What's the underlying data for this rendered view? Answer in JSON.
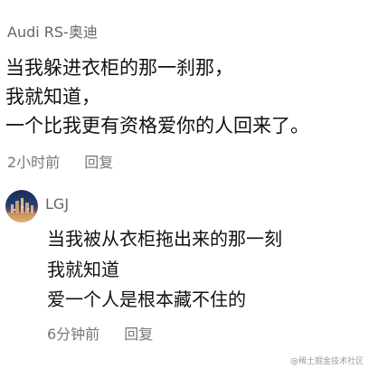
{
  "comment": {
    "username": "Audi RS-奥迪",
    "lines": [
      "当我躲进衣柜的那一刹那，",
      "我就知道，",
      "一个比我更有资格爱你的人回来了。"
    ],
    "time": "2小时前",
    "reply_label": "回复"
  },
  "reply_comment": {
    "username": "LGJ",
    "lines": [
      "当我被从衣柜拖出来的那一刻",
      "我就知道",
      "爱一个人是根本藏不住的"
    ],
    "time": "6分钟前",
    "reply_label": "回复"
  },
  "watermark": "@稀土掘金技术社区"
}
